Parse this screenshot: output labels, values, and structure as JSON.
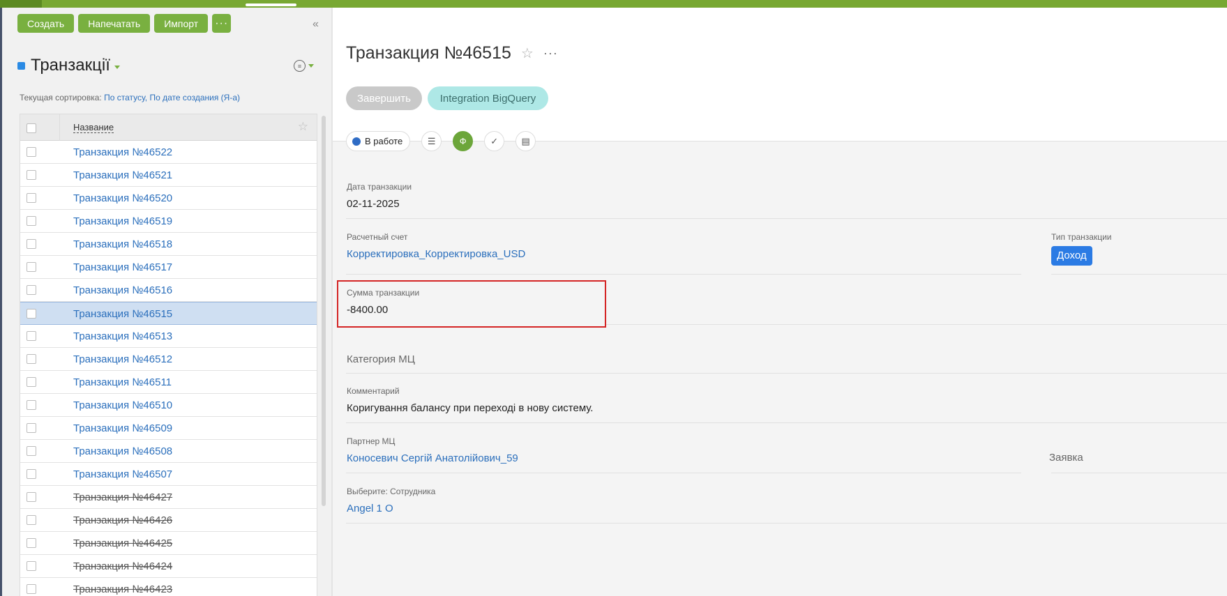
{
  "toolbar": {
    "create": "Создать",
    "print": "Напечатать",
    "import": "Импорт",
    "more": "···"
  },
  "list": {
    "title": "Транзакції",
    "sort_label": "Текущая сортировка:",
    "sort_status": "По статусу,",
    "sort_date": "По дате создания (Я-а)",
    "column_name": "Название",
    "rows": [
      {
        "label": "Транзакция №46522",
        "struck": false,
        "selected": false
      },
      {
        "label": "Транзакция №46521",
        "struck": false,
        "selected": false
      },
      {
        "label": "Транзакция №46520",
        "struck": false,
        "selected": false
      },
      {
        "label": "Транзакция №46519",
        "struck": false,
        "selected": false
      },
      {
        "label": "Транзакция №46518",
        "struck": false,
        "selected": false
      },
      {
        "label": "Транзакция №46517",
        "struck": false,
        "selected": false
      },
      {
        "label": "Транзакция №46516",
        "struck": false,
        "selected": false
      },
      {
        "label": "Транзакция №46515",
        "struck": false,
        "selected": true
      },
      {
        "label": "Транзакция №46513",
        "struck": false,
        "selected": false
      },
      {
        "label": "Транзакция №46512",
        "struck": false,
        "selected": false
      },
      {
        "label": "Транзакция №46511",
        "struck": false,
        "selected": false
      },
      {
        "label": "Транзакция №46510",
        "struck": false,
        "selected": false
      },
      {
        "label": "Транзакция №46509",
        "struck": false,
        "selected": false
      },
      {
        "label": "Транзакция №46508",
        "struck": false,
        "selected": false
      },
      {
        "label": "Транзакция №46507",
        "struck": false,
        "selected": false
      },
      {
        "label": "Транзакция №46427",
        "struck": true,
        "selected": false
      },
      {
        "label": "Транзакция №46426",
        "struck": true,
        "selected": false
      },
      {
        "label": "Транзакция №46425",
        "struck": true,
        "selected": false
      },
      {
        "label": "Транзакция №46424",
        "struck": true,
        "selected": false
      },
      {
        "label": "Транзакция №46423",
        "struck": true,
        "selected": false
      }
    ]
  },
  "record": {
    "title": "Транзакция №46515",
    "finish_button": "Завершить",
    "bigquery_button": "Integration BigQuery",
    "status": "В работе",
    "fields": {
      "date_label": "Дата транзакции",
      "date_value": "02-11-2025",
      "account_label": "Расчетный счет",
      "account_value": "Корректировка_Корректировка_USD",
      "type_label": "Тип транзакции",
      "type_value": "Доход",
      "amount_label": "Сумма транзакции",
      "amount_value": "-8400.00",
      "category_label": "Категория МЦ",
      "comment_label": "Комментарий",
      "comment_value": "Коригування балансу при переході в нову систему.",
      "partner_label": "Партнер МЦ",
      "partner_value": "Коносевич Сергій Анатолійович_59",
      "request_label": "Заявка",
      "employee_label": "Выберите: Сотрудника",
      "employee_value": "Angel 1 O"
    }
  },
  "colors": {
    "brand_green": "#78a832",
    "link_blue": "#2b6fbc",
    "badge_blue": "#2b7be4",
    "highlight_red": "#d42424"
  }
}
